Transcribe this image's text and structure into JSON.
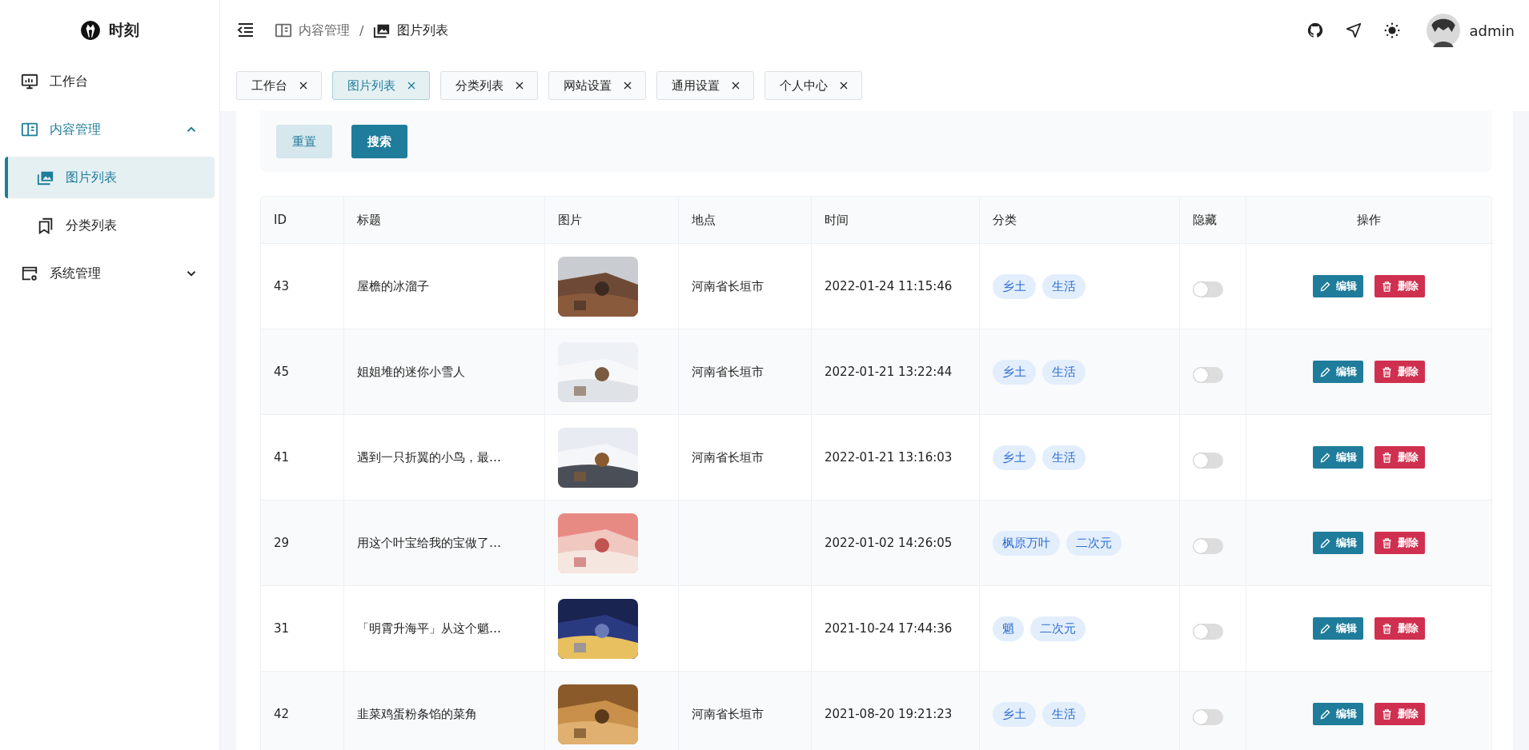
{
  "logo": {
    "title": "时刻"
  },
  "sidebar": {
    "items": [
      {
        "label": "工作台",
        "selected": false
      },
      {
        "label": "内容管理",
        "selected": false,
        "active": true,
        "expanded": true,
        "children": [
          {
            "label": "图片列表",
            "selected": true
          },
          {
            "label": "分类列表",
            "selected": false
          }
        ]
      },
      {
        "label": "系统管理",
        "selected": false,
        "active": false,
        "expanded": false
      }
    ]
  },
  "breadcrumb": [
    {
      "label": "内容管理"
    },
    {
      "label": "图片列表"
    }
  ],
  "breadcrumb_separator": "/",
  "user": {
    "name": "admin"
  },
  "tabs": [
    {
      "label": "工作台",
      "selected": false
    },
    {
      "label": "图片列表",
      "selected": true
    },
    {
      "label": "分类列表",
      "selected": false
    },
    {
      "label": "网站设置",
      "selected": false
    },
    {
      "label": "通用设置",
      "selected": false
    },
    {
      "label": "个人中心",
      "selected": false
    }
  ],
  "search": {
    "buttons": [
      {
        "label": "重置",
        "kind": "secondary"
      },
      {
        "label": "搜索",
        "kind": "primary"
      }
    ]
  },
  "table": {
    "columns": [
      "ID",
      "标题",
      "图片",
      "地点",
      "时间",
      "分类",
      "隐藏",
      "操作"
    ],
    "rows": [
      {
        "id": "43",
        "title": "屋檐的冰溜子",
        "location": "河南省长垣市",
        "time": "2022-01-24 11:15:46",
        "tags": [
          "乡土",
          "生活"
        ],
        "hidden": false,
        "actions": [
          {
            "label": "编辑",
            "kind": "edit"
          },
          {
            "label": "删除",
            "kind": "delete"
          }
        ]
      },
      {
        "id": "45",
        "title": "姐姐堆的迷你小雪人",
        "location": "河南省长垣市",
        "time": "2022-01-21 13:22:44",
        "tags": [
          "乡土",
          "生活"
        ],
        "hidden": false,
        "actions": [
          {
            "label": "编辑",
            "kind": "edit"
          },
          {
            "label": "删除",
            "kind": "delete"
          }
        ]
      },
      {
        "id": "41",
        "title": "遇到一只折翼的小鸟，最…",
        "location": "河南省长垣市",
        "time": "2022-01-21 13:16:03",
        "tags": [
          "乡土",
          "生活"
        ],
        "hidden": false,
        "actions": [
          {
            "label": "编辑",
            "kind": "edit"
          },
          {
            "label": "删除",
            "kind": "delete"
          }
        ]
      },
      {
        "id": "29",
        "title": "用这个叶宝给我的宝做了…",
        "location": "",
        "time": "2022-01-02 14:26:05",
        "tags": [
          "枫原万叶",
          "二次元"
        ],
        "hidden": false,
        "actions": [
          {
            "label": "编辑",
            "kind": "edit"
          },
          {
            "label": "删除",
            "kind": "delete"
          }
        ]
      },
      {
        "id": "31",
        "title": "「明霄升海平」从这个魈…",
        "location": "",
        "time": "2021-10-24 17:44:36",
        "tags": [
          "魈",
          "二次元"
        ],
        "hidden": false,
        "actions": [
          {
            "label": "编辑",
            "kind": "edit"
          },
          {
            "label": "删除",
            "kind": "delete"
          }
        ]
      },
      {
        "id": "42",
        "title": "韭菜鸡蛋粉条馅的菜角",
        "location": "河南省长垣市",
        "time": "2021-08-20 19:21:23",
        "tags": [
          "乡土",
          "生活"
        ],
        "hidden": false,
        "actions": [
          {
            "label": "编辑",
            "kind": "edit"
          },
          {
            "label": "删除",
            "kind": "delete"
          }
        ]
      }
    ]
  }
}
